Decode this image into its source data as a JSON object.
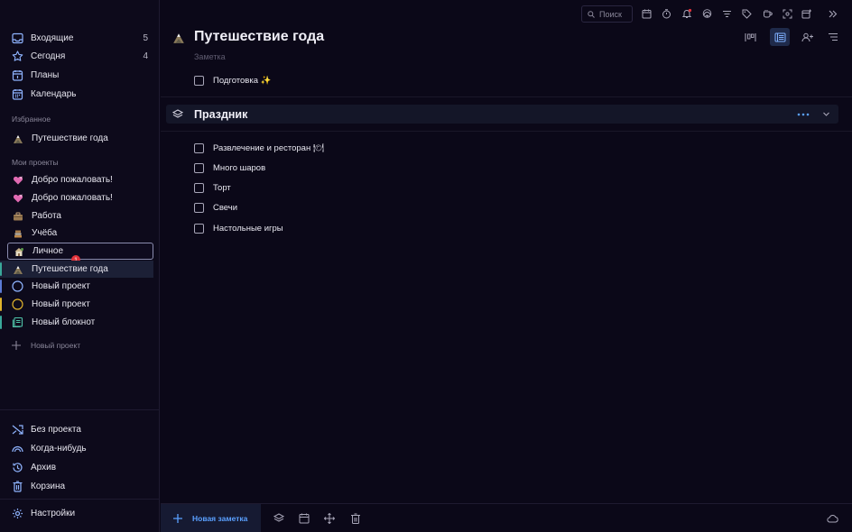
{
  "sidebar": {
    "nav": [
      {
        "label": "Входящие",
        "count": "5",
        "icon": "inbox-icon"
      },
      {
        "label": "Сегодня",
        "count": "4",
        "icon": "star-icon"
      },
      {
        "label": "Планы",
        "count": "",
        "icon": "plans-calendar-icon"
      },
      {
        "label": "Календарь",
        "count": "",
        "icon": "calendar-icon"
      }
    ],
    "favorites_label": "Избранное",
    "favorites": [
      {
        "label": "Путешествие года",
        "icon": "mountain-emoji-icon"
      }
    ],
    "projects_label": "Мои проекты",
    "projects": [
      {
        "label": "Добро пожаловать!",
        "icon": "heart-emoji-icon",
        "color": ""
      },
      {
        "label": "Добро пожаловать!",
        "icon": "heart-emoji-icon",
        "color": ""
      },
      {
        "label": "Работа",
        "icon": "briefcase-emoji-icon",
        "color": ""
      },
      {
        "label": "Учёба",
        "icon": "books-emoji-icon",
        "color": ""
      },
      {
        "label": "Личное",
        "icon": "house-emoji-icon",
        "color": ""
      },
      {
        "label": "Путешествие года",
        "icon": "mountain-emoji-icon",
        "color": "#3aa89a"
      },
      {
        "label": "Новый проект",
        "icon": "circle-icon",
        "color": "#5b7bd6"
      },
      {
        "label": "Новый проект",
        "icon": "circle-icon",
        "color": "#e0b32c"
      },
      {
        "label": "Новый блокнот",
        "icon": "notebook-icon",
        "color": "#3aa89a"
      }
    ],
    "badge": "1",
    "new_project": "Новый проект",
    "bottom_nav": [
      {
        "label": "Без проекта",
        "icon": "shuffle-icon"
      },
      {
        "label": "Когда-нибудь",
        "icon": "rainbow-icon"
      },
      {
        "label": "Архив",
        "icon": "history-icon"
      },
      {
        "label": "Корзина",
        "icon": "trash-icon"
      }
    ],
    "settings": "Настройки"
  },
  "header": {
    "search_placeholder": "Поиск",
    "title": "Путешествие года",
    "note_placeholder": "Заметка"
  },
  "tasks_top": [
    {
      "label": "Подготовка ✨",
      "checked": false
    }
  ],
  "group": {
    "title": "Праздник",
    "tasks": [
      {
        "label": "Развлечение и ресторан 🍽",
        "checked": false
      },
      {
        "label": "Много шаров",
        "checked": false
      },
      {
        "label": "Торт",
        "checked": false
      },
      {
        "label": "Свечи",
        "checked": false
      },
      {
        "label": "Настольные игры",
        "checked": false
      }
    ]
  },
  "bottombar": {
    "new_note": "Новая заметка"
  },
  "colors": {
    "accent": "#5aa0ff",
    "background": "#0b0818",
    "badge": "#e0333b"
  }
}
